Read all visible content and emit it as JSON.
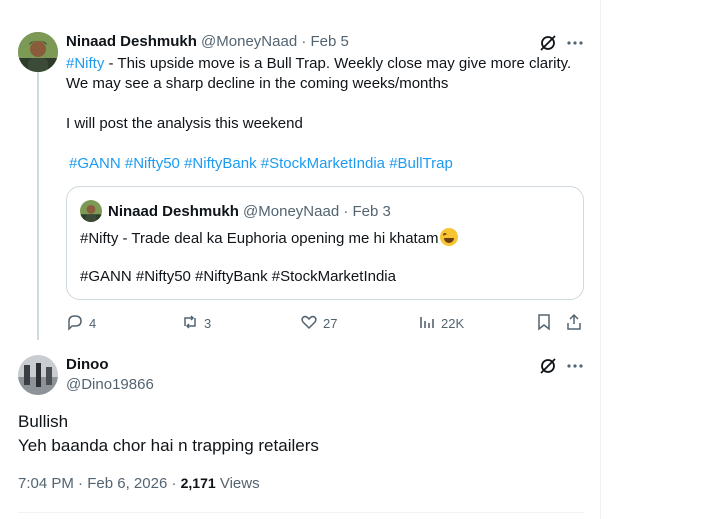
{
  "colors": {
    "link": "#1d9bf0",
    "muted": "#536471",
    "text": "#0f1419",
    "border": "#cfd9de"
  },
  "tweet1": {
    "display_name": "Ninaad Deshmukh",
    "handle": "@MoneyNaad",
    "sep": "·",
    "date": "Feb 5",
    "hashtag_lead": "#Nifty",
    "line1_rest": " - This upside move is a Bull Trap. Weekly close may give more clarity.",
    "line2": "We may see a sharp decline in the coming weeks/months",
    "line3": "I will post the analysis this weekend",
    "hashtags": [
      "#GANN",
      "#Nifty50",
      "#NiftyBank",
      "#StockMarketIndia",
      "#BullTrap"
    ],
    "quote": {
      "display_name": "Ninaad Deshmukh",
      "handle": "@MoneyNaad",
      "sep": "·",
      "date": "Feb 3",
      "line1": "#Nifty - Trade deal ka Euphoria opening me hi khatam",
      "line2": "#GANN #Nifty50 #NiftyBank #StockMarketIndia"
    },
    "actions": {
      "replies": "4",
      "reposts": "3",
      "likes": "27",
      "views": "22K"
    },
    "icons": [
      "grok-icon",
      "more-icon",
      "reply-icon",
      "repost-icon",
      "like-icon",
      "views-icon",
      "bookmark-icon",
      "share-icon"
    ]
  },
  "tweet2": {
    "display_name": "Dinoo",
    "handle": "@Dino19866",
    "line1": "Bullish",
    "line2": "Yeh baanda chor hai n trapping retailers",
    "time": "7:04 PM",
    "sep": "·",
    "date": "Feb 6, 2026",
    "sep2": "·",
    "views_count": "2,171",
    "views_label": "Views"
  }
}
